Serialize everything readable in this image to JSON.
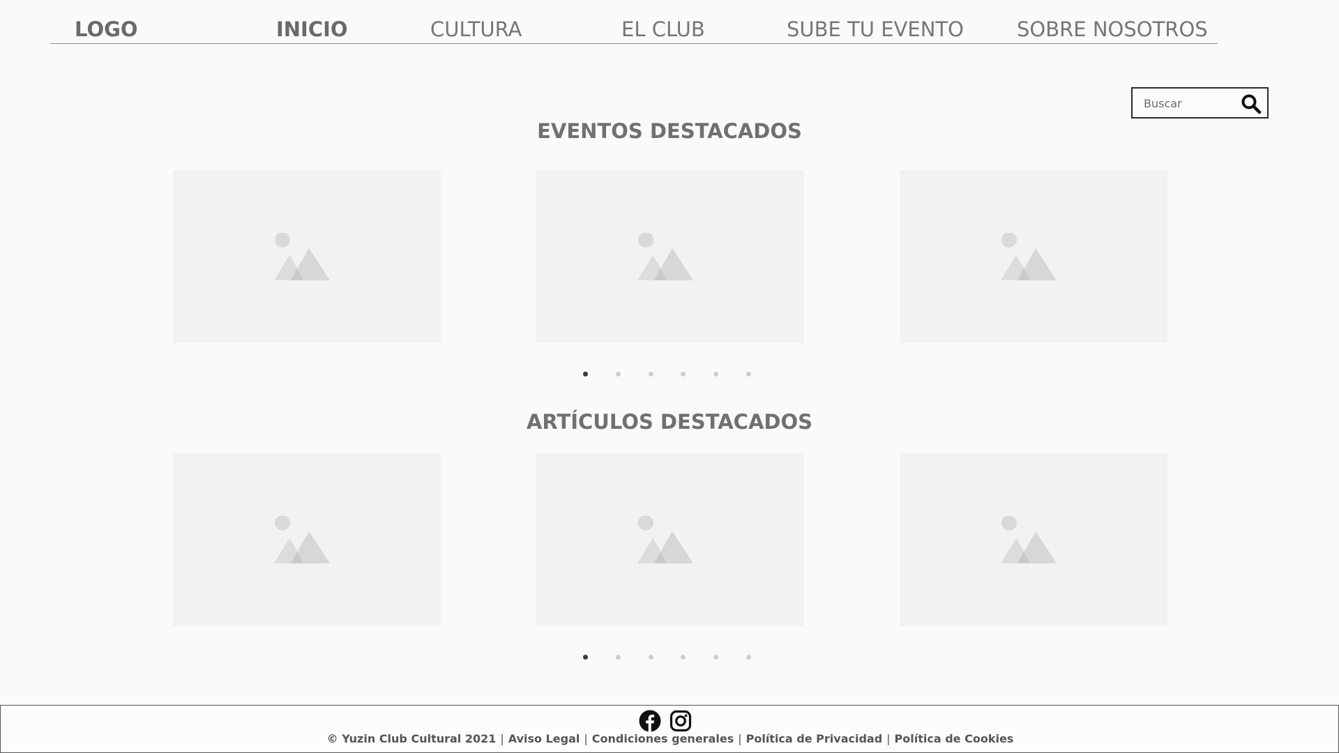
{
  "nav": {
    "logo": "LOGO",
    "items": [
      {
        "label": "INICIO",
        "active": true
      },
      {
        "label": "CULTURA",
        "active": false
      },
      {
        "label": "EL CLUB",
        "active": false
      },
      {
        "label": "SUBE TU EVENTO",
        "active": false
      },
      {
        "label": "SOBRE NOSOTROS",
        "active": false
      }
    ]
  },
  "search": {
    "placeholder": "Buscar",
    "icon": "search-icon"
  },
  "sections": [
    {
      "title": "EVENTOS DESTACADOS",
      "cards": [
        {
          "icon": "image-placeholder-icon"
        },
        {
          "icon": "image-placeholder-icon"
        },
        {
          "icon": "image-placeholder-icon"
        }
      ],
      "dots": {
        "total": 6,
        "active_index": 0
      }
    },
    {
      "title": "ARTÍCULOS DESTACADOS",
      "cards": [
        {
          "icon": "image-placeholder-icon"
        },
        {
          "icon": "image-placeholder-icon"
        },
        {
          "icon": "image-placeholder-icon"
        }
      ],
      "dots": {
        "total": 6,
        "active_index": 0
      }
    }
  ],
  "footer": {
    "social_icons": [
      "facebook-icon",
      "instagram-icon"
    ],
    "copyright": "© Yuzin Club Cultural 2021",
    "links": [
      "Aviso Legal",
      "Condiciones generales",
      "Política de Privacidad",
      "Política de Cookies"
    ],
    "separator": "|"
  },
  "colors": {
    "background": "#fafafa",
    "text": "#707070",
    "placeholder": "#f2f2f2",
    "dot_active": "#3a3a3a",
    "dot_inactive": "#cfcfcf"
  }
}
